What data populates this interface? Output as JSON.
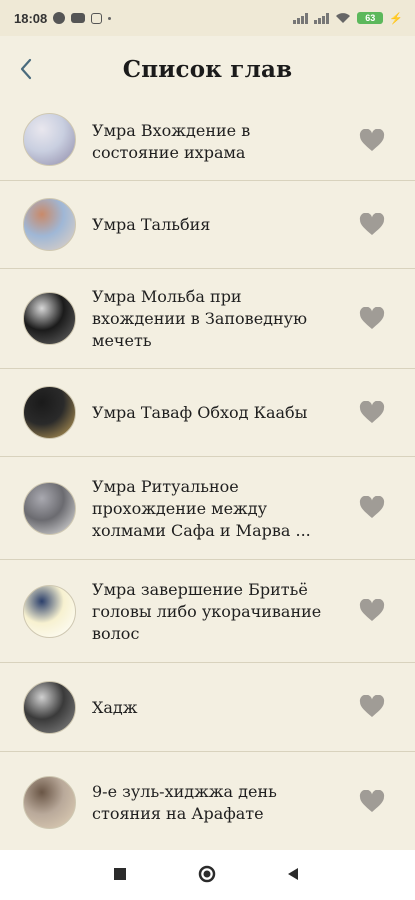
{
  "status_bar": {
    "time": "18:08",
    "battery": "63",
    "left_icons": [
      "circle-app-icon",
      "youtube-icon",
      "instagram-icon",
      "dot-icon"
    ],
    "right_icons": [
      "signal-icon",
      "signal-icon",
      "wifi-icon",
      "battery-icon",
      "charging-icon"
    ]
  },
  "header": {
    "title": "Список глав",
    "back_icon": "chevron-left-icon"
  },
  "chapters": [
    {
      "label": "Умра  Вхождение в состояние ихрама",
      "thumb_colors": [
        "#c9cfe0",
        "#8f8aa8",
        "#e9e7ee"
      ],
      "favorite": false
    },
    {
      "label": "Умра   Тальбия",
      "thumb_colors": [
        "#9fb7d6",
        "#e6d3c2",
        "#c98a6a"
      ],
      "favorite": false
    },
    {
      "label": "Умра   Мольба при вхождении в Заповедную мечеть",
      "thumb_colors": [
        "#1b1b1b",
        "#6a6a6a",
        "#d7d7d7"
      ],
      "favorite": false
    },
    {
      "label": "Умра     Таваф Обход Каабы",
      "thumb_colors": [
        "#2a2a2a",
        "#c8a55a",
        "#1a1a1a"
      ],
      "favorite": false
    },
    {
      "label": "Умра Ритуальное прохождение между холмами Сафа и Марва ...",
      "thumb_colors": [
        "#6b6b70",
        "#e6e6e6",
        "#a9a9b0"
      ],
      "favorite": false
    },
    {
      "label": "Умра завершение Бритьё головы либо укорачивание волос",
      "thumb_colors": [
        "#f7f1d0",
        "#ffffff",
        "#2b3f6b"
      ],
      "favorite": false
    },
    {
      "label": "Хадж",
      "thumb_colors": [
        "#3a3a3a",
        "#8a8a8a",
        "#d0d0d0"
      ],
      "favorite": false
    },
    {
      "label": "9-е зуль-хиджжа день стояния на Арафате",
      "thumb_colors": [
        "#b9a99a",
        "#e2d2b8",
        "#6a5646"
      ],
      "favorite": false
    }
  ],
  "colors": {
    "background": "#f3efe1",
    "heart": "#a09c96",
    "divider": "#d8d2bd"
  },
  "nav_bar": {
    "icons": [
      "recent-apps-icon",
      "home-icon",
      "back-triangle-icon"
    ]
  }
}
